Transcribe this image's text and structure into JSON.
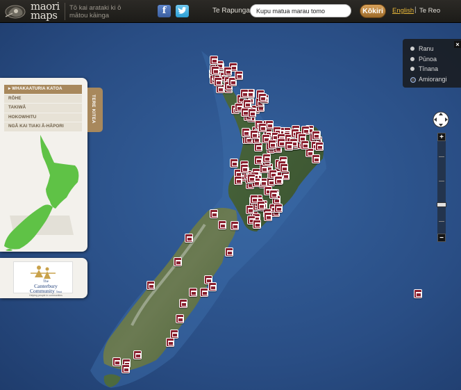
{
  "header": {
    "logo_line1": "maori",
    "logo_line2": "maps",
    "tagline": "Tō kai arataki ki ō mātou kāinga",
    "search_label": "Te Rapunga",
    "search_value": "Kupu matua marau tomo",
    "search_button": "Kōkiri",
    "lang_english": "English",
    "lang_separator": "|",
    "lang_maori": "Te Reo",
    "facebook_icon": "f",
    "twitter_icon": "t"
  },
  "categories": {
    "items": [
      {
        "label": "WHAKAATURIA KATOA",
        "active": true
      },
      {
        "label": "RŌHE",
        "active": false
      },
      {
        "label": "TAKIWĀ",
        "active": false
      },
      {
        "label": "HOKOWHITU",
        "active": false
      },
      {
        "label": "NGĀ KAI TIAKI Ā-HĀPORI",
        "active": false
      }
    ],
    "tab_label": "TERE KITEA"
  },
  "sponsor": {
    "name_line1": "The",
    "name_line2": "Canterbury",
    "name_line3": "Community",
    "name_suffix": "Trust",
    "tagline": "Helping people in communities"
  },
  "map_types": {
    "options": [
      {
        "label": "Ranu",
        "selected": false
      },
      {
        "label": "Pūnoa",
        "selected": false
      },
      {
        "label": "Tīnana",
        "selected": false
      },
      {
        "label": "Amiorangi",
        "selected": true
      }
    ],
    "close_label": "×"
  },
  "zoom": {
    "in_label": "+",
    "out_label": "−",
    "level_fraction": 0.65
  },
  "colors": {
    "ocean": "#2c4f86",
    "land": "#3f5a3a",
    "marker": "#8a1f2e",
    "accent": "#a8885c",
    "thumb_land": "#5fc246"
  }
}
